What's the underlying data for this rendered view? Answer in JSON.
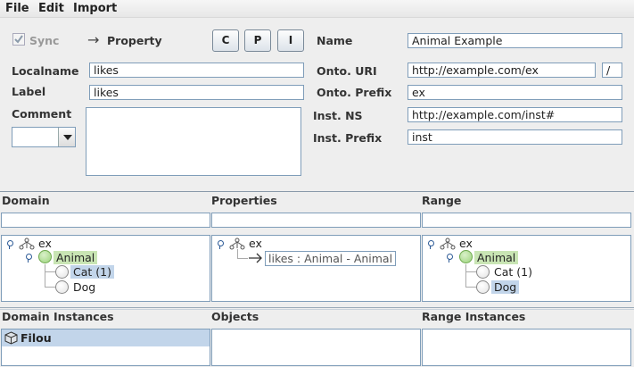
{
  "menu": {
    "file": "File",
    "edit": "Edit",
    "import": "Import"
  },
  "toolbar": {
    "sync_label": "Sync",
    "sync_checked": true,
    "mode_arrow": "→",
    "mode_label": "Property",
    "c_label": "C",
    "p_label": "P",
    "i_label": "I"
  },
  "left_form": {
    "localname_label": "Localname",
    "localname_value": "likes",
    "label_label": "Label",
    "label_value": "likes",
    "comment_label": "Comment",
    "comment_value": ""
  },
  "right_form": {
    "name_label": "Name",
    "name_value": "Animal Example",
    "onto_uri_label": "Onto. URI",
    "onto_uri_value": "http://example.com/ex",
    "onto_uri_sep": "/",
    "onto_prefix_label": "Onto. Prefix",
    "onto_prefix_value": "ex",
    "inst_ns_label": "Inst. NS",
    "inst_ns_value": "http://example.com/inst#",
    "inst_prefix_label": "Inst. Prefix",
    "inst_prefix_value": "inst"
  },
  "panels": {
    "domain": "Domain",
    "properties": "Properties",
    "range": "Range",
    "domain_instances": "Domain Instances",
    "objects": "Objects",
    "range_instances": "Range Instances"
  },
  "domain_tree": {
    "root": "ex",
    "class": "Animal",
    "children": [
      "Cat (1)",
      "Dog"
    ],
    "selected": "Cat (1)"
  },
  "properties_tree": {
    "root": "ex",
    "property": "likes : Animal - Animal"
  },
  "range_tree": {
    "root": "ex",
    "class": "Animal",
    "children": [
      "Cat (1)",
      "Dog"
    ],
    "selected": "Dog"
  },
  "domain_instances": [
    "Filou"
  ],
  "icons": {
    "hierarchy": "hierarchy-icon",
    "class": "class-circle-icon",
    "instance": "cube-icon",
    "arrow": "arrow-right-icon"
  },
  "colors": {
    "selection_blue": "#c2d5ea",
    "class_green": "#c9e5b4",
    "field_border": "#7f9db9"
  }
}
